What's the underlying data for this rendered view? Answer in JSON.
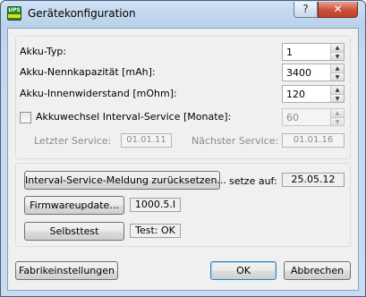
{
  "window": {
    "title": "Gerätekonfiguration",
    "icon_text": "UPS",
    "help_glyph": "?",
    "close_glyph": "✕"
  },
  "battery": {
    "type_label": "Akku-Typ:",
    "type_value": "1",
    "capacity_label": "Akku-Nennkapazität [mAh]:",
    "capacity_value": "3400",
    "resistance_label": "Akku-Innenwiderstand [mOhm]:",
    "resistance_value": "120",
    "interval_label": "Akkuwechsel Interval-Service [Monate]:",
    "interval_value": "60",
    "interval_checked": false,
    "last_service_label": "Letzter Service:",
    "last_service_value": "01.01.11",
    "next_service_label": "Nächster Service:",
    "next_service_value": "01.01.16"
  },
  "actions": {
    "reset_button": "Interval-Service-Meldung zurücksetzen...",
    "set_to_label": "setze auf:",
    "set_to_value": "25.05.12",
    "firmware_button": "Firmwareupdate...",
    "firmware_value": "1000.5.I",
    "selftest_button": "Selbsttest",
    "selftest_value": "Test: OK"
  },
  "footer": {
    "factory_button": "Fabrikeinstellungen",
    "ok_button": "OK",
    "cancel_button": "Abbrechen"
  },
  "icons": {
    "spin_up": "▲",
    "spin_down": "▼"
  },
  "colors": {
    "title_gradient_top": "#cfe1f4",
    "close_button": "#c9503a",
    "default_button_border": "#3c7fb1",
    "icon_green": "#1a8a2a",
    "icon_yellow": "#f2d21b"
  }
}
